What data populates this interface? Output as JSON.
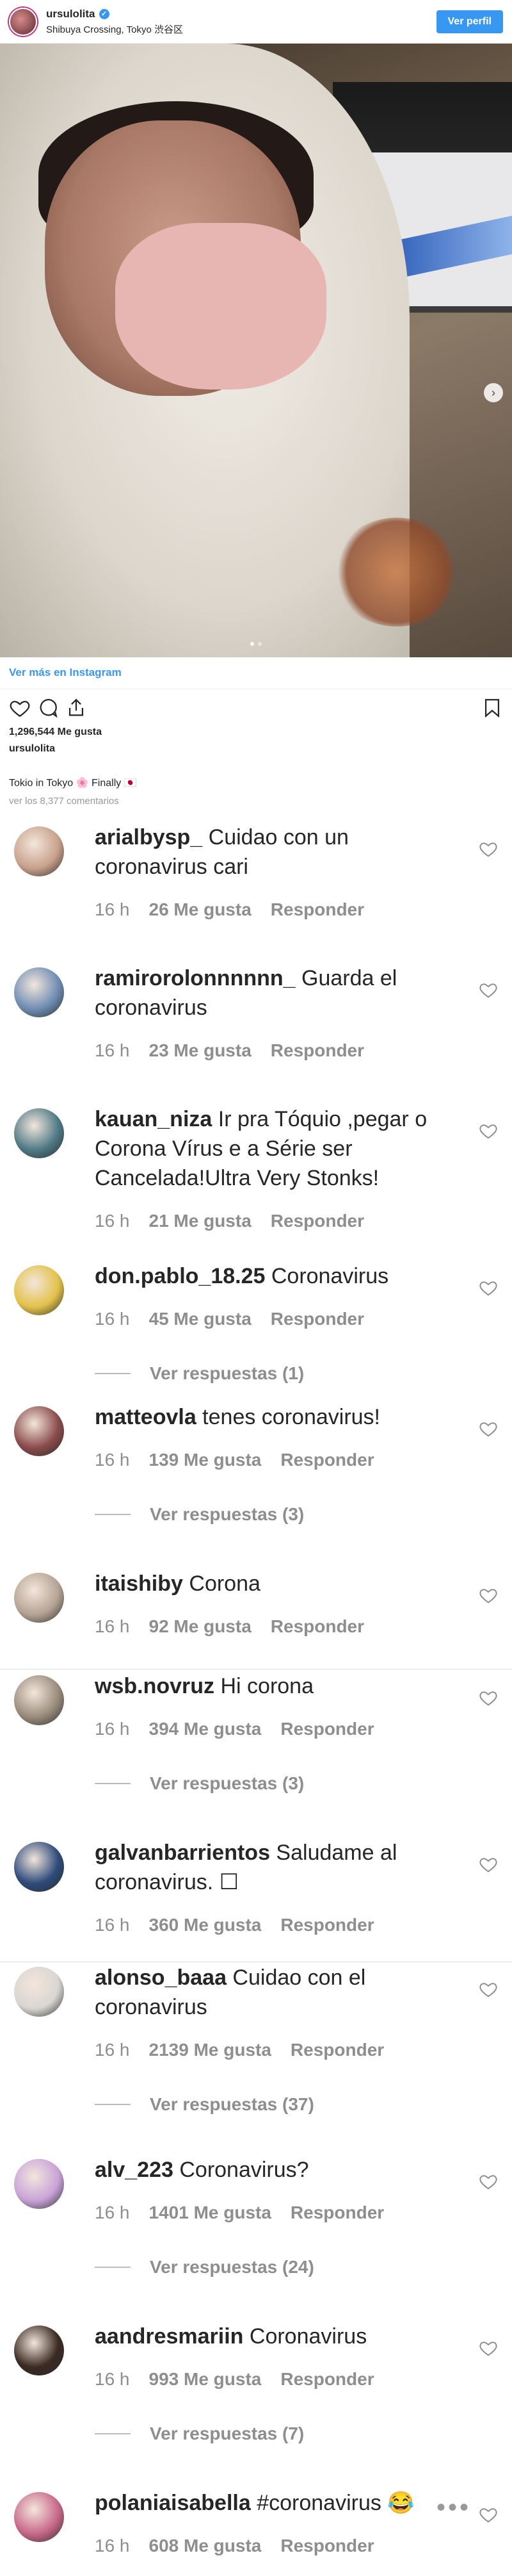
{
  "header": {
    "username": "ursulolita",
    "location": "Shibuya Crossing, Tokyo 渋谷区",
    "profile_button": "Ver perfil"
  },
  "post": {
    "view_more_link": "Ver más en Instagram",
    "likes": "1,296,544 Me gusta",
    "caption_user": "ursulolita",
    "caption": "Tokio in Tokyo 🌸 Finally 🇯🇵",
    "view_comments": "ver los 8,377 comentarios"
  },
  "comments": [
    {
      "user": "arialbysp_",
      "text": "Cuidao con un coronavirus cari",
      "time": "16 h",
      "likes": "26 Me gusta",
      "reply": "Responder",
      "replies": "",
      "avatar_color": "#c9a18c"
    },
    {
      "user": "ramirorolonnnnnn_",
      "text": "Guarda el coronavirus",
      "time": "16 h",
      "likes": "23 Me gusta",
      "reply": "Responder",
      "replies": "",
      "avatar_color": "#6f8db3"
    },
    {
      "user": "kauan_niza",
      "text": "Ir pra Tóquio ,pegar o Corona Vírus e a Série ser Cancelada!Ultra Very Stonks!",
      "time": "16 h",
      "likes": "21 Me gusta",
      "reply": "Responder",
      "replies": "",
      "avatar_color": "#4f7a86"
    },
    {
      "user": "don.pablo_18.25",
      "text": "Coronavirus",
      "time": "16 h",
      "likes": "45 Me gusta",
      "reply": "Responder",
      "replies": "Ver respuestas (1)",
      "avatar_color": "#e3c24a"
    },
    {
      "user": "matteovla",
      "text": "tenes coronavirus!",
      "time": "16 h",
      "likes": "139 Me gusta",
      "reply": "Responder",
      "replies": "Ver respuestas (3)",
      "avatar_color": "#8a4b4b"
    },
    {
      "user": "itaishiby",
      "text": "Corona",
      "time": "16 h",
      "likes": "92 Me gusta",
      "reply": "Responder",
      "replies": "",
      "avatar_color": "#b5a494"
    },
    {
      "user": "wsb.novruz",
      "text": "Hi corona",
      "time": "16 h",
      "likes": "394 Me gusta",
      "reply": "Responder",
      "replies": "Ver respuestas (3)",
      "avatar_color": "#9a8c7c"
    },
    {
      "user": "galvanbarrientos",
      "text": "Saludame al coronavirus. ☐",
      "time": "16 h",
      "likes": "360 Me gusta",
      "reply": "Responder",
      "replies": "",
      "avatar_color": "#2e4b7a"
    },
    {
      "user": "alonso_baaa",
      "text": "Cuidao con el coronavirus",
      "time": "16 h",
      "likes": "2139 Me gusta",
      "reply": "Responder",
      "replies": "Ver respuestas (37)",
      "avatar_color": "#d9d6d2"
    },
    {
      "user": "alv_223",
      "text": "Coronavirus?",
      "time": "16 h",
      "likes": "1401 Me gusta",
      "reply": "Responder",
      "replies": "Ver respuestas (24)",
      "avatar_color": "#c9a3d8"
    },
    {
      "user": "aandresmariin",
      "text": "Coronavirus",
      "time": "16 h",
      "likes": "993 Me gusta",
      "reply": "Responder",
      "replies": "Ver respuestas (7)",
      "avatar_color": "#3a2a22"
    },
    {
      "user": "polaniaisabella",
      "text": "#coronavirus 😂",
      "time": "16 h",
      "likes": "608 Me gusta",
      "reply": "Responder",
      "replies": "",
      "avatar_color": "#c8688a"
    }
  ]
}
